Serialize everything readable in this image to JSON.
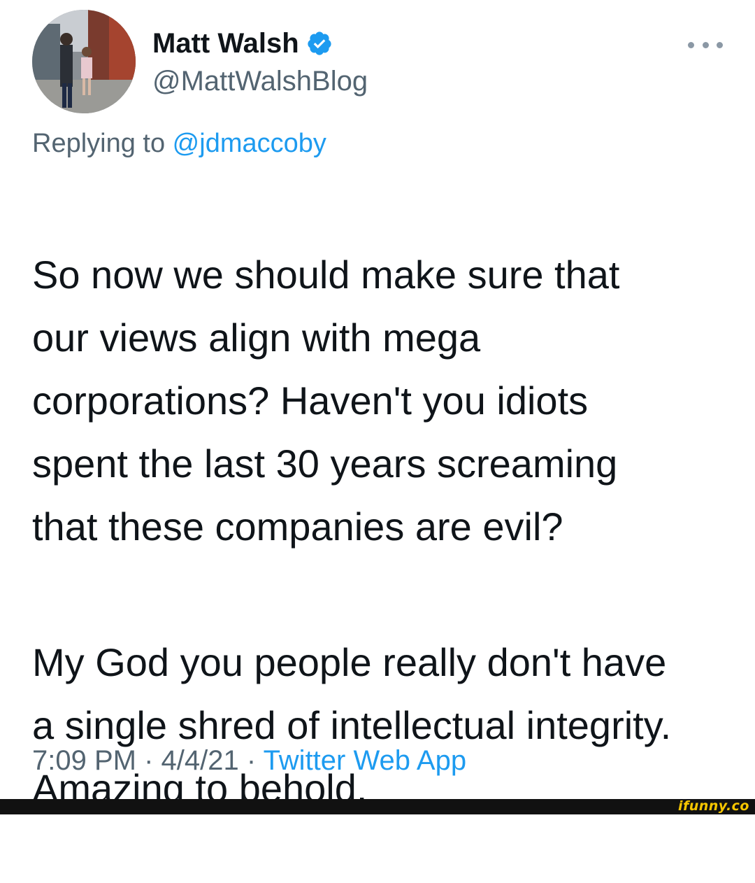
{
  "tweet": {
    "author": {
      "display_name": "Matt Walsh",
      "handle": "@MattWalshBlog",
      "verified": true,
      "avatar_icon": "avatar-photo"
    },
    "more_icon": "more-dots-icon",
    "replying_to_prefix": "Replying to ",
    "replying_to_handle": "@jdmaccoby",
    "paragraphs": [
      "So now we should make sure that\nour views align with mega\ncorporations? Haven't you idiots\nspent the last 30 years screaming\nthat these companies are evil?",
      "My God you people really don't have\na single shred of intellectual integrity.\nAmazing to behold."
    ],
    "time": "7:09 PM",
    "separator": " · ",
    "date": "4/4/21",
    "source": "Twitter Web App"
  },
  "watermark": "ifunny.co",
  "colors": {
    "link": "#1d9bf0",
    "secondary_text": "#536471",
    "primary_text": "#0f1419",
    "verified_badge": "#1d9bf0",
    "footer_bar": "#111111",
    "watermark": "#f7c600"
  }
}
